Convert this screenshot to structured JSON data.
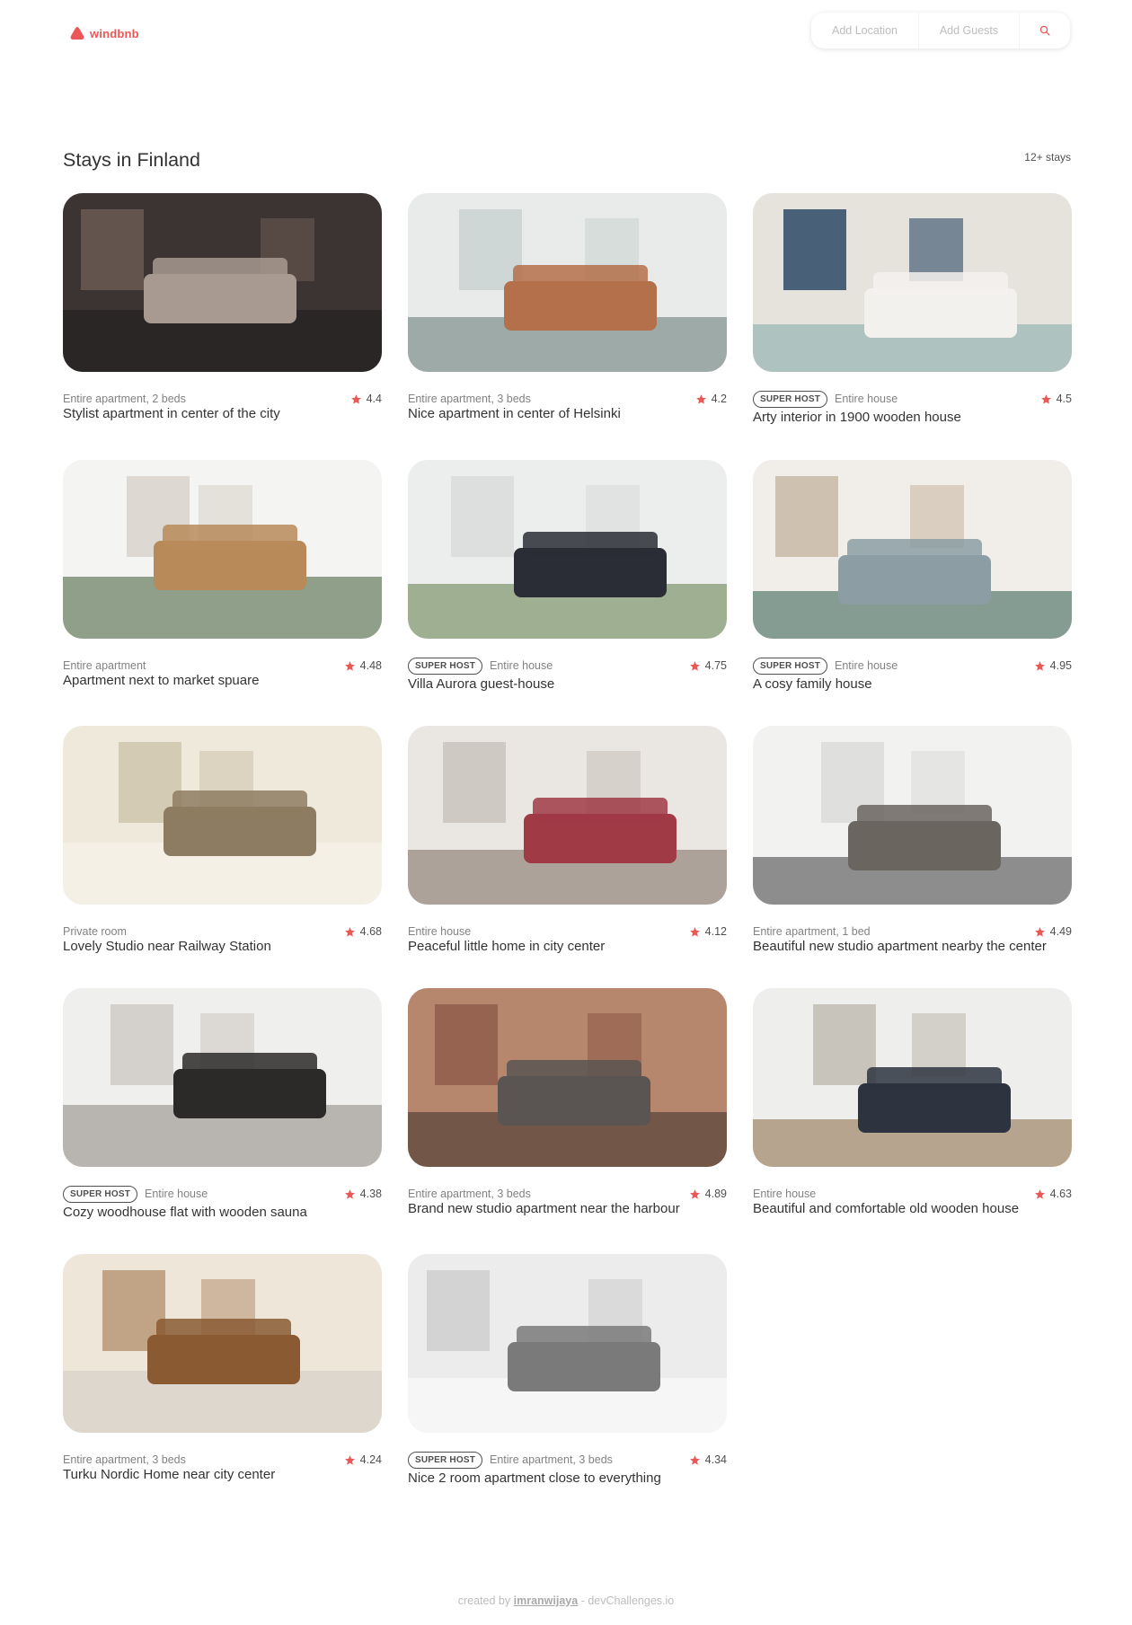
{
  "brand": {
    "name": "windbnb",
    "accent": "#eb5757"
  },
  "search": {
    "location_placeholder": "Add Location",
    "guests_placeholder": "Add Guests",
    "icon": "search-icon"
  },
  "main": {
    "title": "Stays in Finland",
    "count": "12+ stays"
  },
  "stays": [
    {
      "type": "Entire apartment, 2 beds",
      "superhost": "",
      "rating": "4.4",
      "title": "Stylist apartment in center of the city"
    },
    {
      "type": "Entire apartment, 3 beds",
      "superhost": "",
      "rating": "4.2",
      "title": "Nice apartment in center of Helsinki"
    },
    {
      "type": "Entire house",
      "superhost": "SUPER HOST",
      "rating": "4.5",
      "title": "Arty interior in 1900 wooden house"
    },
    {
      "type": "Entire apartment",
      "superhost": "",
      "rating": "4.48",
      "title": "Apartment next to market spuare"
    },
    {
      "type": "Entire house",
      "superhost": "SUPER HOST",
      "rating": "4.75",
      "title": "Villa Aurora guest-house"
    },
    {
      "type": "Entire house",
      "superhost": "SUPER HOST",
      "rating": "4.95",
      "title": "A cosy family house"
    },
    {
      "type": "Private room",
      "superhost": "",
      "rating": "4.68",
      "title": "Lovely Studio near Railway Station"
    },
    {
      "type": "Entire house",
      "superhost": "",
      "rating": "4.12",
      "title": "Peaceful little home in city center"
    },
    {
      "type": "Entire apartment, 1 bed",
      "superhost": "",
      "rating": "4.49",
      "title": "Beautiful new studio apartment nearby the center"
    },
    {
      "type": "Entire house",
      "superhost": "SUPER HOST",
      "rating": "4.38",
      "title": "Cozy woodhouse flat with wooden sauna"
    },
    {
      "type": "Entire apartment, 3 beds",
      "superhost": "",
      "rating": "4.89",
      "title": "Brand new studio apartment near the harbour"
    },
    {
      "type": "Entire house",
      "superhost": "",
      "rating": "4.63",
      "title": "Beautiful and comfortable old wooden house"
    },
    {
      "type": "Entire apartment, 3 beds",
      "superhost": "",
      "rating": "4.24",
      "title": "Turku Nordic Home near city center"
    },
    {
      "type": "Entire apartment, 3 beds",
      "superhost": "SUPER HOST",
      "rating": "4.34",
      "title": "Nice 2 room apartment close to everything"
    }
  ],
  "footer": {
    "prefix": "created by",
    "author": "imranwijaya",
    "suffix": "- devChallenges.io"
  }
}
